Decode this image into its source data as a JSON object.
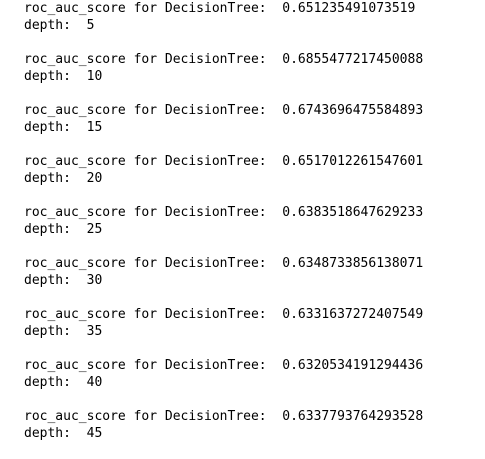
{
  "output": {
    "entries": [
      {
        "score_line": "roc_auc_score for DecisionTree:  0.651235491073519",
        "depth_line": "depth:  5"
      },
      {
        "score_line": "roc_auc_score for DecisionTree:  0.6855477217450088",
        "depth_line": "depth:  10"
      },
      {
        "score_line": "roc_auc_score for DecisionTree:  0.6743696475584893",
        "depth_line": "depth:  15"
      },
      {
        "score_line": "roc_auc_score for DecisionTree:  0.6517012261547601",
        "depth_line": "depth:  20"
      },
      {
        "score_line": "roc_auc_score for DecisionTree:  0.6383518647629233",
        "depth_line": "depth:  25"
      },
      {
        "score_line": "roc_auc_score for DecisionTree:  0.6348733856138071",
        "depth_line": "depth:  30"
      },
      {
        "score_line": "roc_auc_score for DecisionTree:  0.6331637272407549",
        "depth_line": "depth:  35"
      },
      {
        "score_line": "roc_auc_score for DecisionTree:  0.6320534191294436",
        "depth_line": "depth:  40"
      },
      {
        "score_line": "roc_auc_score for DecisionTree:  0.6337793764293528",
        "depth_line": "depth:  45"
      }
    ]
  }
}
